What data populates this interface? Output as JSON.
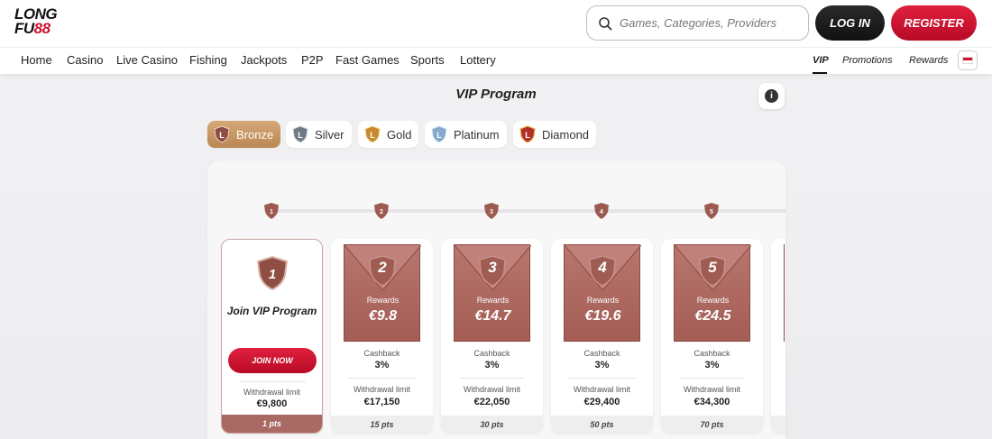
{
  "brand": {
    "logo_line1": "LONG",
    "logo_line2a": "FU",
    "logo_line2b": "88"
  },
  "search": {
    "placeholder": "Games, Categories, Providers"
  },
  "auth": {
    "login_label": "LOG IN",
    "register_label": "REGISTER"
  },
  "nav": {
    "items": [
      "Home",
      "Casino",
      "Live Casino",
      "Fishing",
      "Jackpots",
      "P2P",
      "Fast Games",
      "Sports",
      "Lottery"
    ],
    "right": [
      "VIP",
      "Promotions",
      "Rewards"
    ],
    "active": "VIP"
  },
  "page": {
    "title": "VIP Program",
    "info_icon": "i"
  },
  "tiers": [
    {
      "label": "Bronze",
      "active": true,
      "color": "#9b5a4e"
    },
    {
      "label": "Silver",
      "active": false,
      "color": "#7a8590"
    },
    {
      "label": "Gold",
      "active": false,
      "color": "#c78a2c"
    },
    {
      "label": "Platinum",
      "active": false,
      "color": "#7aa0c8"
    },
    {
      "label": "Diamond",
      "active": false,
      "color": "#b03028"
    }
  ],
  "steps": [
    "1",
    "2",
    "3",
    "4",
    "5"
  ],
  "join_card": {
    "level": "1",
    "title": "Join VIP Program",
    "button": "JOIN NOW",
    "withdrawal_label": "Withdrawal limit",
    "withdrawal_value": "€9,800",
    "points": "1 pts"
  },
  "level_cards": [
    {
      "level": "2",
      "rewards_label": "Rewards",
      "rewards": "€9.8",
      "cashback_label": "Cashback",
      "cashback": "3%",
      "withdrawal_label": "Withdrawal limit",
      "withdrawal": "€17,150",
      "points": "15 pts"
    },
    {
      "level": "3",
      "rewards_label": "Rewards",
      "rewards": "€14.7",
      "cashback_label": "Cashback",
      "cashback": "3%",
      "withdrawal_label": "Withdrawal limit",
      "withdrawal": "€22,050",
      "points": "30 pts"
    },
    {
      "level": "4",
      "rewards_label": "Rewards",
      "rewards": "€19.6",
      "cashback_label": "Cashback",
      "cashback": "3%",
      "withdrawal_label": "Withdrawal limit",
      "withdrawal": "€29,400",
      "points": "50 pts"
    },
    {
      "level": "5",
      "rewards_label": "Rewards",
      "rewards": "€24.5",
      "cashback_label": "Cashback",
      "cashback": "3%",
      "withdrawal_label": "Withdrawal limit",
      "withdrawal": "€34,300",
      "points": "70 pts"
    }
  ],
  "colors": {
    "accent": "#d0102f",
    "bronze": "#a35d54"
  }
}
